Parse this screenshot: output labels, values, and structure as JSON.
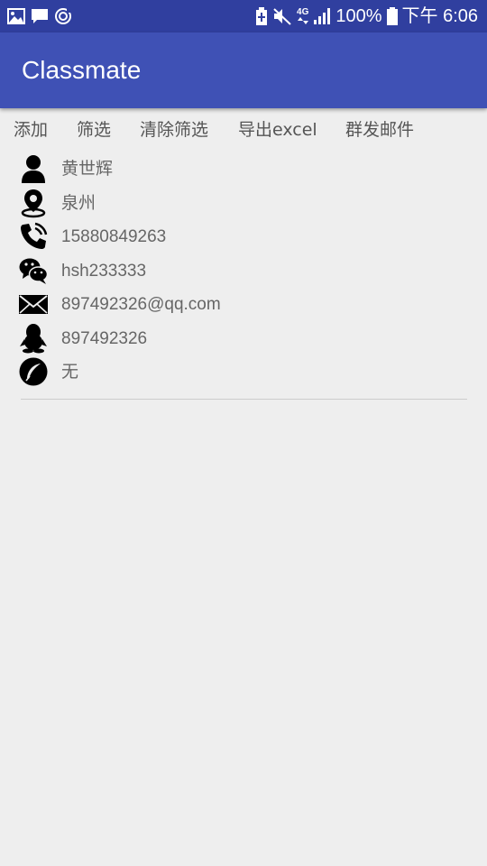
{
  "status_bar": {
    "battery_percent": "100%",
    "time": "下午 6:06",
    "network": "4G",
    "icons": [
      "image-icon",
      "message-icon",
      "sync-icon",
      "battery-saver-icon",
      "mute-icon",
      "network-4g-icon",
      "signal-icon",
      "battery-icon"
    ]
  },
  "app_bar": {
    "title": "Classmate",
    "color": "#3f51b5",
    "status_color": "#303f9f"
  },
  "actions": {
    "add": "添加",
    "filter": "筛选",
    "clear_filter": "清除筛选",
    "export_excel": "导出excel",
    "group_email": "群发邮件"
  },
  "contact": {
    "name": "黄世辉",
    "location": "泉州",
    "phone": "15880849263",
    "wechat": "hsh233333",
    "email": "897492326@qq.com",
    "qq": "897492326",
    "weibo": "无"
  }
}
